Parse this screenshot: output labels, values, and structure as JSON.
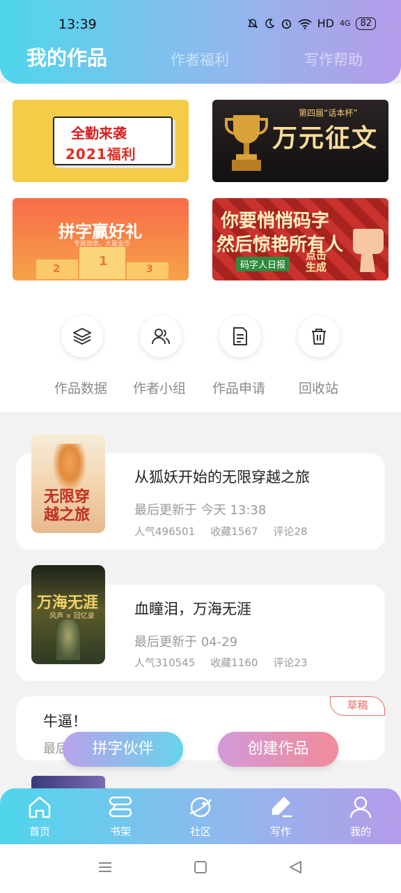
{
  "status": {
    "time": "13:39",
    "network": "HD",
    "signal": "4G",
    "battery": "82"
  },
  "tabs": [
    {
      "label": "我的作品",
      "active": true
    },
    {
      "label": "作者福利",
      "active": false
    },
    {
      "label": "写作帮助",
      "active": false
    }
  ],
  "banners": {
    "b1": {
      "line1": "全勤来袭",
      "line2": "2021福利"
    },
    "b2": {
      "small": "第四届“话本杯”",
      "big": "万元征文"
    },
    "b3": {
      "title": "拼字赢好礼",
      "sub": "专属勋章，大量金币",
      "ranks": [
        "2",
        "1",
        "3"
      ]
    },
    "b4": {
      "line1": "你要悄悄码字",
      "line2": "然后惊艳所有人",
      "tag": "码字人日报",
      "click": "点击生成"
    }
  },
  "quick_actions": [
    {
      "label": "作品数据",
      "icon": "layers-icon"
    },
    {
      "label": "作者小组",
      "icon": "group-icon"
    },
    {
      "label": "作品申请",
      "icon": "document-icon"
    },
    {
      "label": "回收站",
      "icon": "trash-icon"
    }
  ],
  "works": [
    {
      "title": "从狐妖开始的无限穿越之旅",
      "update": "最后更新于 今天 13:38",
      "popularity": "人气496501",
      "favorites": "收藏1567",
      "comments": "评论28",
      "cover_text": "无限穿越之旅"
    },
    {
      "title": "血瞳泪，万海无涯",
      "update": "最后更新于 04-29",
      "popularity": "人气310545",
      "favorites": "收藏1160",
      "comments": "评论23",
      "cover_text": "万海无涯",
      "cover_sub": "风声 × 回忆录"
    },
    {
      "title": "牛逼！",
      "update": "最后",
      "badge": "草稿"
    }
  ],
  "fab": {
    "partner": "拼字伙伴",
    "create": "创建作品"
  },
  "bottom_nav": [
    {
      "label": "首页",
      "icon": "home-icon"
    },
    {
      "label": "书架",
      "icon": "bookshelf-icon"
    },
    {
      "label": "社区",
      "icon": "planet-icon"
    },
    {
      "label": "写作",
      "icon": "pen-icon",
      "active": true
    },
    {
      "label": "我的",
      "icon": "profile-icon"
    }
  ]
}
